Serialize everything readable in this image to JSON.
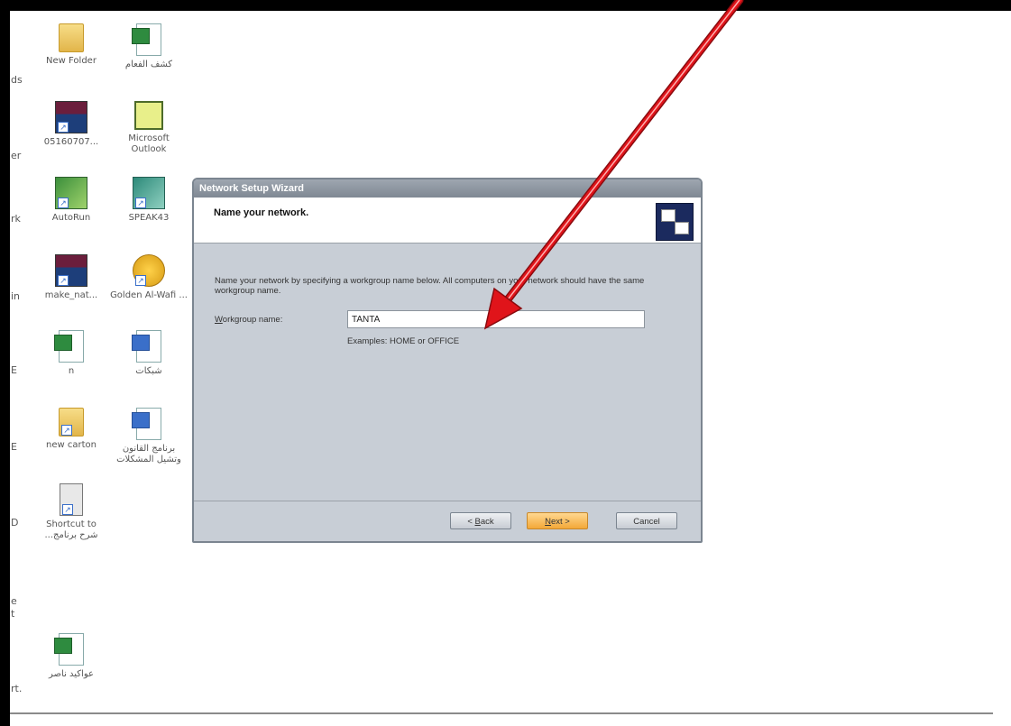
{
  "desktop": {
    "cut_labels": [
      "ds",
      "er",
      "rk",
      "in",
      "E",
      "E",
      "D",
      "e",
      "t",
      "rt."
    ],
    "icons": [
      {
        "label": "New Folder",
        "icon": "folder-icon"
      },
      {
        "label": "كشف الفعام",
        "icon": "excel-document-icon"
      },
      {
        "label": "05160707...",
        "icon": "video-shortcut-icon"
      },
      {
        "label": "Microsoft Outlook",
        "icon": "outlook-icon"
      },
      {
        "label": "AutoRun",
        "icon": "autorun-icon"
      },
      {
        "label": "SPEAK43",
        "icon": "application-icon"
      },
      {
        "label": "make_nat...",
        "icon": "video-shortcut-icon"
      },
      {
        "label": "Golden Al-Wafi ...",
        "icon": "golden-disc-icon"
      },
      {
        "label": "n",
        "icon": "excel-document-icon"
      },
      {
        "label": "شبكات",
        "icon": "word-document-icon"
      },
      {
        "label": "new carton",
        "icon": "folder-shortcut-icon"
      },
      {
        "label": "برنامج القانون وتشيل المشكلات",
        "icon": "word-document-icon"
      },
      {
        "label": "Shortcut to ...شرح برنامج",
        "icon": "shortcut-icon"
      },
      {
        "label": "عواكيد ناصر",
        "icon": "excel-document-icon"
      }
    ]
  },
  "wizard": {
    "title": "Network Setup Wizard",
    "heading": "Name your network.",
    "description": "Name your network by specifying a workgroup name below. All computers on your network should have the same workgroup name.",
    "workgroup_label_accel": "W",
    "workgroup_label_rest": "orkgroup name:",
    "workgroup_value": "TANTA",
    "example": "Examples: HOME or OFFICE",
    "buttons": {
      "back_prefix": "< ",
      "back_accel": "B",
      "back_rest": "ack",
      "next_accel": "N",
      "next_rest": "ext >",
      "cancel": "Cancel"
    }
  },
  "annotation": {
    "arrow_color": "#e0141a"
  },
  "colors": {
    "frame": "#000000",
    "wizard_background": "#c8ced6",
    "next_button": "#f3a838"
  }
}
